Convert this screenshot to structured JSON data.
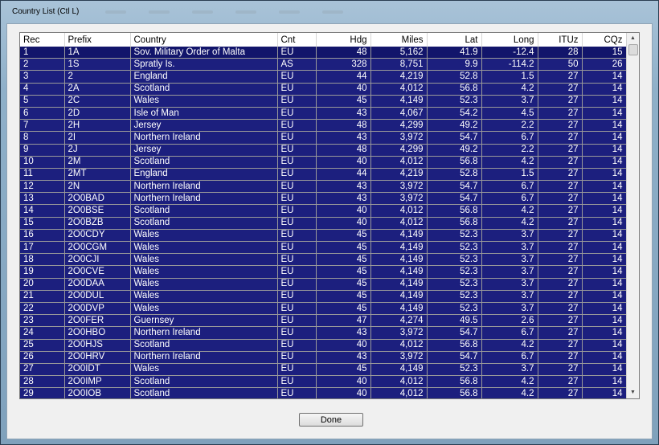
{
  "window": {
    "title": "Country List (Ctl L)"
  },
  "table": {
    "columns": [
      "Rec",
      "Prefix",
      "Country",
      "Cnt",
      "Hdg",
      "Miles",
      "Lat",
      "Long",
      "ITUz",
      "CQz"
    ],
    "rows": [
      [
        "1",
        "1A",
        "Sov. Military Order of Malta",
        "EU",
        "48",
        "5,162",
        "41.9",
        "-12.4",
        "28",
        "15"
      ],
      [
        "2",
        "1S",
        "Spratly Is.",
        "AS",
        "328",
        "8,751",
        "9.9",
        "-114.2",
        "50",
        "26"
      ],
      [
        "3",
        "2",
        "England",
        "EU",
        "44",
        "4,219",
        "52.8",
        "1.5",
        "27",
        "14"
      ],
      [
        "4",
        "2A",
        "Scotland",
        "EU",
        "40",
        "4,012",
        "56.8",
        "4.2",
        "27",
        "14"
      ],
      [
        "5",
        "2C",
        "Wales",
        "EU",
        "45",
        "4,149",
        "52.3",
        "3.7",
        "27",
        "14"
      ],
      [
        "6",
        "2D",
        "Isle of Man",
        "EU",
        "43",
        "4,067",
        "54.2",
        "4.5",
        "27",
        "14"
      ],
      [
        "7",
        "2H",
        "Jersey",
        "EU",
        "48",
        "4,299",
        "49.2",
        "2.2",
        "27",
        "14"
      ],
      [
        "8",
        "2I",
        "Northern Ireland",
        "EU",
        "43",
        "3,972",
        "54.7",
        "6.7",
        "27",
        "14"
      ],
      [
        "9",
        "2J",
        "Jersey",
        "EU",
        "48",
        "4,299",
        "49.2",
        "2.2",
        "27",
        "14"
      ],
      [
        "10",
        "2M",
        "Scotland",
        "EU",
        "40",
        "4,012",
        "56.8",
        "4.2",
        "27",
        "14"
      ],
      [
        "11",
        "2MT",
        "England",
        "EU",
        "44",
        "4,219",
        "52.8",
        "1.5",
        "27",
        "14"
      ],
      [
        "12",
        "2N",
        "Northern Ireland",
        "EU",
        "43",
        "3,972",
        "54.7",
        "6.7",
        "27",
        "14"
      ],
      [
        "13",
        "2O0BAD",
        "Northern Ireland",
        "EU",
        "43",
        "3,972",
        "54.7",
        "6.7",
        "27",
        "14"
      ],
      [
        "14",
        "2O0BSE",
        "Scotland",
        "EU",
        "40",
        "4,012",
        "56.8",
        "4.2",
        "27",
        "14"
      ],
      [
        "15",
        "2O0BZB",
        "Scotland",
        "EU",
        "40",
        "4,012",
        "56.8",
        "4.2",
        "27",
        "14"
      ],
      [
        "16",
        "2O0CDY",
        "Wales",
        "EU",
        "45",
        "4,149",
        "52.3",
        "3.7",
        "27",
        "14"
      ],
      [
        "17",
        "2O0CGM",
        "Wales",
        "EU",
        "45",
        "4,149",
        "52.3",
        "3.7",
        "27",
        "14"
      ],
      [
        "18",
        "2O0CJI",
        "Wales",
        "EU",
        "45",
        "4,149",
        "52.3",
        "3.7",
        "27",
        "14"
      ],
      [
        "19",
        "2O0CVE",
        "Wales",
        "EU",
        "45",
        "4,149",
        "52.3",
        "3.7",
        "27",
        "14"
      ],
      [
        "20",
        "2O0DAA",
        "Wales",
        "EU",
        "45",
        "4,149",
        "52.3",
        "3.7",
        "27",
        "14"
      ],
      [
        "21",
        "2O0DUL",
        "Wales",
        "EU",
        "45",
        "4,149",
        "52.3",
        "3.7",
        "27",
        "14"
      ],
      [
        "22",
        "2O0DVP",
        "Wales",
        "EU",
        "45",
        "4,149",
        "52.3",
        "3.7",
        "27",
        "14"
      ],
      [
        "23",
        "2O0FER",
        "Guernsey",
        "EU",
        "47",
        "4,274",
        "49.5",
        "2.6",
        "27",
        "14"
      ],
      [
        "24",
        "2O0HBO",
        "Northern Ireland",
        "EU",
        "43",
        "3,972",
        "54.7",
        "6.7",
        "27",
        "14"
      ],
      [
        "25",
        "2O0HJS",
        "Scotland",
        "EU",
        "40",
        "4,012",
        "56.8",
        "4.2",
        "27",
        "14"
      ],
      [
        "26",
        "2O0HRV",
        "Northern Ireland",
        "EU",
        "43",
        "3,972",
        "54.7",
        "6.7",
        "27",
        "14"
      ],
      [
        "27",
        "2O0IDT",
        "Wales",
        "EU",
        "45",
        "4,149",
        "52.3",
        "3.7",
        "27",
        "14"
      ],
      [
        "28",
        "2O0IMP",
        "Scotland",
        "EU",
        "40",
        "4,012",
        "56.8",
        "4.2",
        "27",
        "14"
      ],
      [
        "29",
        "2O0IOB",
        "Scotland",
        "EU",
        "40",
        "4,012",
        "56.8",
        "4.2",
        "27",
        "14"
      ]
    ]
  },
  "icons": {
    "scroll_up": "scroll-up-icon",
    "scroll_down": "scroll-down-icon"
  },
  "colors": {
    "row_bg": "#1c1f7e",
    "row_text": "#ffffff",
    "client_bg": "#f0f0f0"
  },
  "buttons": {
    "done_label": "Done"
  }
}
